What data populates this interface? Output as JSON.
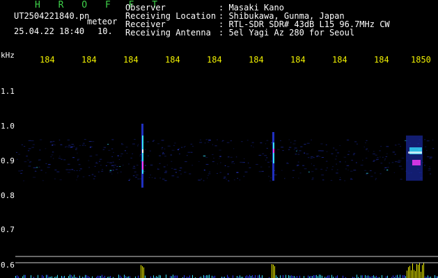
{
  "header": {
    "station": "H R O F F T",
    "filename": "UT2504221840.pn",
    "type": "meteor",
    "datetime": "25.04.22 18:40",
    "count": "10."
  },
  "meta": [
    {
      "label": "Observer",
      "value": ": Masaki Kano"
    },
    {
      "label": "Receiving Location",
      "value": ": Shibukawa, Gunma, Japan"
    },
    {
      "label": "Receiver",
      "value": ": RTL-SDR SDR# 43dB L15 96.7MHz CW"
    },
    {
      "label": "Receiving Antenna",
      "value": ": 5el Yagi Az 280 for Seoul"
    }
  ],
  "axis": {
    "y_unit": "kHz",
    "x_ticks": [
      "184",
      "184",
      "184",
      "184",
      "184",
      "184",
      "184",
      "184",
      "184",
      "1850"
    ],
    "y_ticks": [
      "1.1",
      "1.0",
      "0.9",
      "0.8",
      "0.7",
      "0.6"
    ]
  },
  "colors": {
    "station": "#3fd24a",
    "text": "#ffffff",
    "ticks": "#f0f000",
    "gridline": "#cfcfcf",
    "signal_blue": "#2d3cff",
    "signal_cyan": "#36e0ff",
    "signal_magenta": "#ff3cff",
    "signal_yellow": "#f0f000"
  }
}
